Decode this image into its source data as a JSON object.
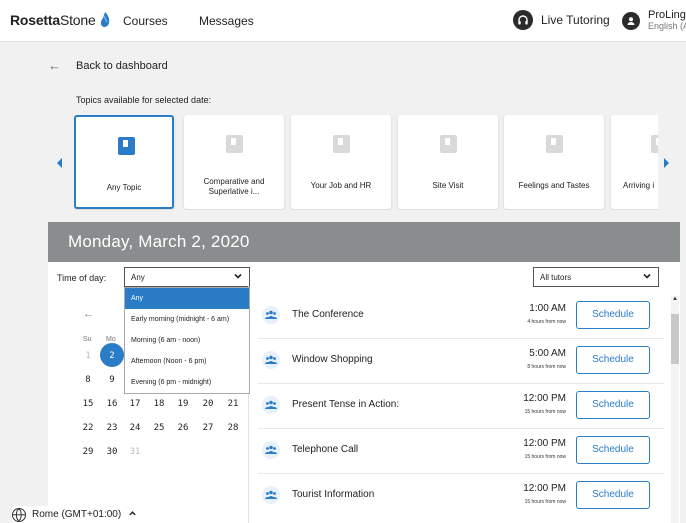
{
  "nav": {
    "logo_bold": "Rosetta",
    "logo_light": "Stone",
    "courses": "Courses",
    "messages": "Messages",
    "live_tutoring": "Live Tutoring",
    "profile_name": "ProLingu",
    "profile_sub": "English (A"
  },
  "back_label": "Back to dashboard",
  "topics_title": "Topics available for selected date:",
  "topics": [
    {
      "label": "Any Topic"
    },
    {
      "label": "Comparative and Superlative i..."
    },
    {
      "label": "Your Job and HR"
    },
    {
      "label": "Site Visit"
    },
    {
      "label": "Feelings and Tastes"
    },
    {
      "label": "Arriving i"
    }
  ],
  "date_header": "Monday, March 2, 2020",
  "filters": {
    "time_of_day_label": "Time of day:",
    "time_of_day_value": "Any",
    "tutor_value": "All tutors",
    "options": [
      "Any",
      "Early morning (midnight - 6 am)",
      "Morning (6 am - noon)",
      "Afternoon (Noon - 6 pm)",
      "Evening (6 pm - midnight)"
    ]
  },
  "calendar": {
    "weekdays": [
      "Su",
      "Mo"
    ],
    "row1": [
      "1",
      "2"
    ],
    "row2": [
      "8",
      "9"
    ],
    "row3": [
      "15",
      "16",
      "17",
      "18",
      "19",
      "20",
      "21"
    ],
    "row4": [
      "22",
      "23",
      "24",
      "25",
      "26",
      "27",
      "28"
    ],
    "row5": [
      "29",
      "30",
      "31"
    ]
  },
  "sessions": [
    {
      "title": "The Conference",
      "time": "1:00 AM",
      "rel": "4 hours from now",
      "btn": "Schedule"
    },
    {
      "title": "Window Shopping",
      "time": "5:00 AM",
      "rel": "8 hours from now",
      "btn": "Schedule"
    },
    {
      "title": "Present Tense in Action:",
      "time": "12:00 PM",
      "rel": "15 hours from now",
      "btn": "Schedule"
    },
    {
      "title": "Telephone Call",
      "time": "12:00 PM",
      "rel": "15 hours from now",
      "btn": "Schedule"
    },
    {
      "title": "Tourist Information",
      "time": "12:00 PM",
      "rel": "15 hours from now",
      "btn": "Schedule"
    }
  ],
  "timezone": "Rome (GMT+01:00)",
  "colors": {
    "accent": "#2a7cc7",
    "header_gray": "#8a8d8e"
  }
}
